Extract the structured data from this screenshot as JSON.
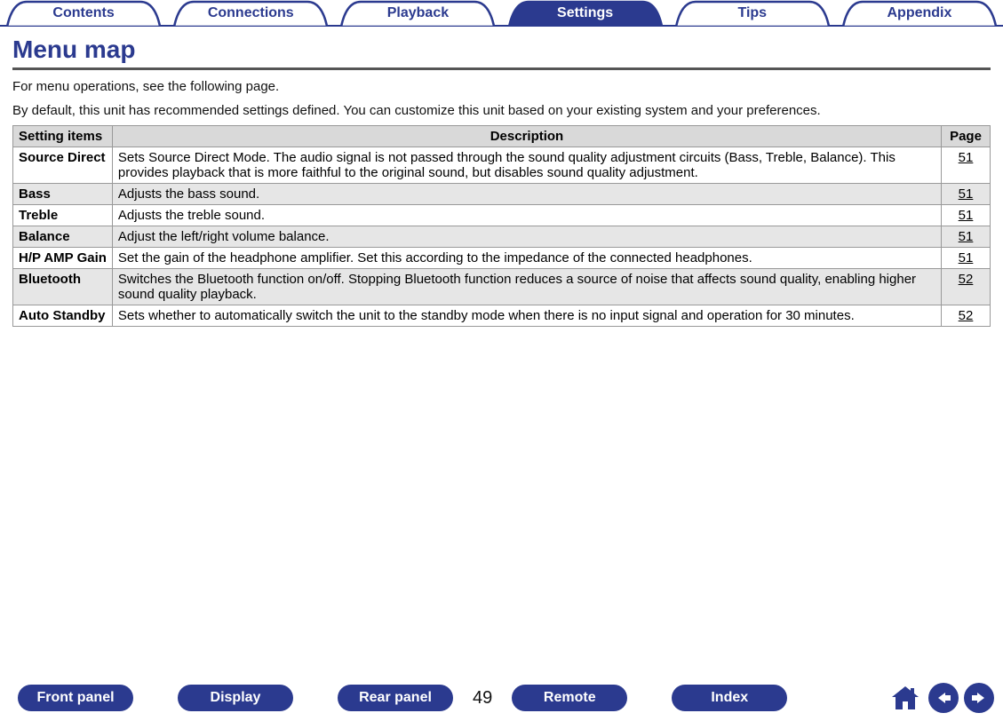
{
  "topnav": {
    "tabs": [
      {
        "label": "Contents",
        "active": false
      },
      {
        "label": "Connections",
        "active": false
      },
      {
        "label": "Playback",
        "active": false
      },
      {
        "label": "Settings",
        "active": true
      },
      {
        "label": "Tips",
        "active": false
      },
      {
        "label": "Appendix",
        "active": false
      }
    ]
  },
  "title": "Menu map",
  "intro1": "For menu operations, see the following page.",
  "intro2": "By default, this unit has recommended settings defined. You can customize this unit based on your existing system and your preferences.",
  "table": {
    "headers": {
      "item": "Setting items",
      "desc": "Description",
      "page": "Page"
    },
    "rows": [
      {
        "item": "Source Direct",
        "desc": "Sets Source Direct Mode. The audio signal is not passed through the sound quality adjustment circuits (Bass, Treble, Balance). This provides playback that is more faithful to the original sound, but disables sound quality adjustment.",
        "page": "51",
        "shaded": false
      },
      {
        "item": "Bass",
        "desc": "Adjusts the bass sound.",
        "page": "51",
        "shaded": true
      },
      {
        "item": "Treble",
        "desc": "Adjusts the treble sound.",
        "page": "51",
        "shaded": false
      },
      {
        "item": "Balance",
        "desc": "Adjust the left/right volume balance.",
        "page": "51",
        "shaded": true
      },
      {
        "item": "H/P AMP Gain",
        "desc": "Set the gain of the headphone amplifier. Set this according to the impedance of the connected headphones.",
        "page": "51",
        "shaded": false
      },
      {
        "item": "Bluetooth",
        "desc": "Switches the Bluetooth function on/off. Stopping Bluetooth function reduces a source of noise that affects sound quality, enabling higher sound quality playback.",
        "page": "52",
        "shaded": true
      },
      {
        "item": "Auto Standby",
        "desc": "Sets whether to automatically switch the unit to the standby mode when there is no input signal and operation for 30 minutes.",
        "page": "52",
        "shaded": false
      }
    ]
  },
  "bottom": {
    "pills": [
      "Front panel",
      "Display",
      "Rear panel"
    ],
    "page_number": "49",
    "pills2": [
      "Remote",
      "Index"
    ]
  }
}
